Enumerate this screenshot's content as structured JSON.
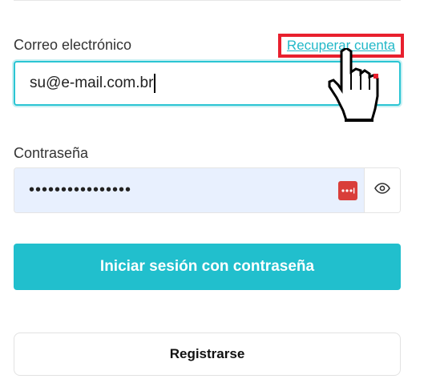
{
  "form": {
    "email_label": "Correo electrónico",
    "recover_link": "Recuperar cuenta",
    "email_value": "su@e-mail.com.br",
    "password_label": "Contraseña",
    "password_value": "••••••••••••••••",
    "login_button": "Iniciar sesión con contraseña",
    "register_button": "Registrarse"
  },
  "icons": {
    "password_manager": "password-manager-icon",
    "show_password": "eye-icon",
    "cursor": "hand-pointer-cursor"
  },
  "colors": {
    "accent": "#21bfcd",
    "link": "#21b8c8",
    "highlight_box": "#e8202e",
    "autofill_bg": "#e8f0fe",
    "password_manager_icon": "#d93e3a"
  }
}
